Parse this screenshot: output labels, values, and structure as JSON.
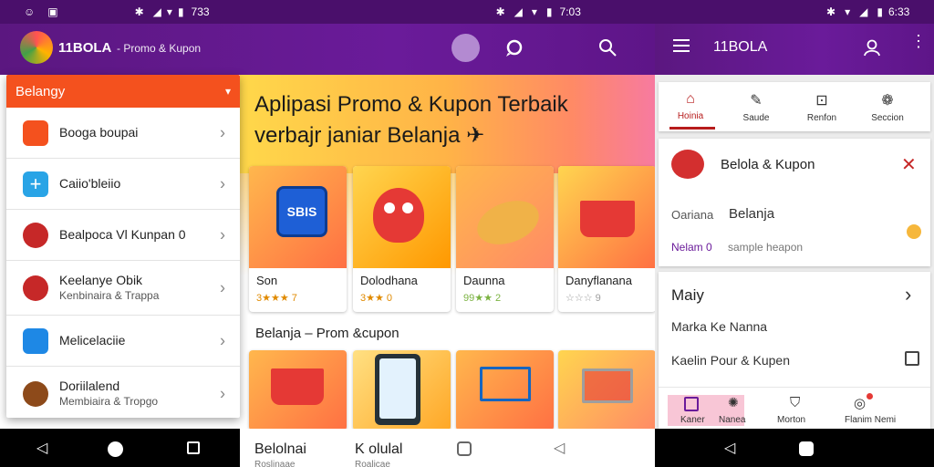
{
  "status": {
    "left_icons": [
      "☺",
      "▣"
    ],
    "left_time": "733",
    "mid_time": "7:03",
    "right_time": "6:33"
  },
  "left_app": {
    "brand": "11BOLA",
    "subtitle": "- Promo & Kupon",
    "search_icon": "search-icon",
    "chat_icon": "chat-icon"
  },
  "dropdown": {
    "title": "Belangy",
    "items": [
      {
        "label": "Booga boupai",
        "sub": "",
        "color": "#f4511e"
      },
      {
        "label": "Caiio'bleiio",
        "sub": "",
        "color": "#29a4e6"
      },
      {
        "label": "Bealpoca Vl Kunpan 0",
        "sub": "",
        "color": "#c62828"
      },
      {
        "label": "Keelanye Obik",
        "sub": "Kenbinaira & Trappa",
        "color": "#c62828"
      },
      {
        "label": "Melicelaciie",
        "sub": "",
        "color": "#1e88e5"
      },
      {
        "label": "Doriilalend",
        "sub": "Membiaira & Tropgo",
        "color": "#8d4a1a"
      }
    ]
  },
  "hero": {
    "line1": "Aplipasi Promo & Kupon Terbaik",
    "line2": "verbajr janiar Belanja ✈"
  },
  "cards": [
    {
      "title": "Son",
      "rating": "3★★★ 7",
      "color": "#e08a00"
    },
    {
      "title": "Dolodhana",
      "rating": "3★★ 0",
      "color": "#e08a00"
    },
    {
      "title": "Daunna",
      "rating": "99★★ 2",
      "color": "#8bc34a"
    },
    {
      "title": "Danyflanana",
      "rating": "☆☆☆ 9",
      "color": "#9e9e9e"
    }
  ],
  "section_title": "Belanja – Prom &cupon",
  "bottom_labels": {
    "left": "Belolnai",
    "left_sub": "Roslinaae",
    "mid": "K olulal",
    "mid_sub": "Roalicae"
  },
  "right_app": {
    "brand": "11BOLA",
    "tabs": [
      {
        "label": "Hoinia"
      },
      {
        "label": "Saude"
      },
      {
        "label": "Renfon"
      },
      {
        "label": "Seccion"
      }
    ],
    "card_title": "Belola & Kupon",
    "field_label": "Oariana",
    "field_value": "Belanja",
    "hint_label": "Nelam 0",
    "hint_text": "sample heapon",
    "section_header": "Maiy",
    "list_items": [
      "Marka Ke Nanna",
      "Kaelin Pour & Kupen"
    ],
    "bottom_tabs": [
      "Kaner",
      "Nanea",
      "Morton",
      "Flanim Nemi"
    ]
  }
}
